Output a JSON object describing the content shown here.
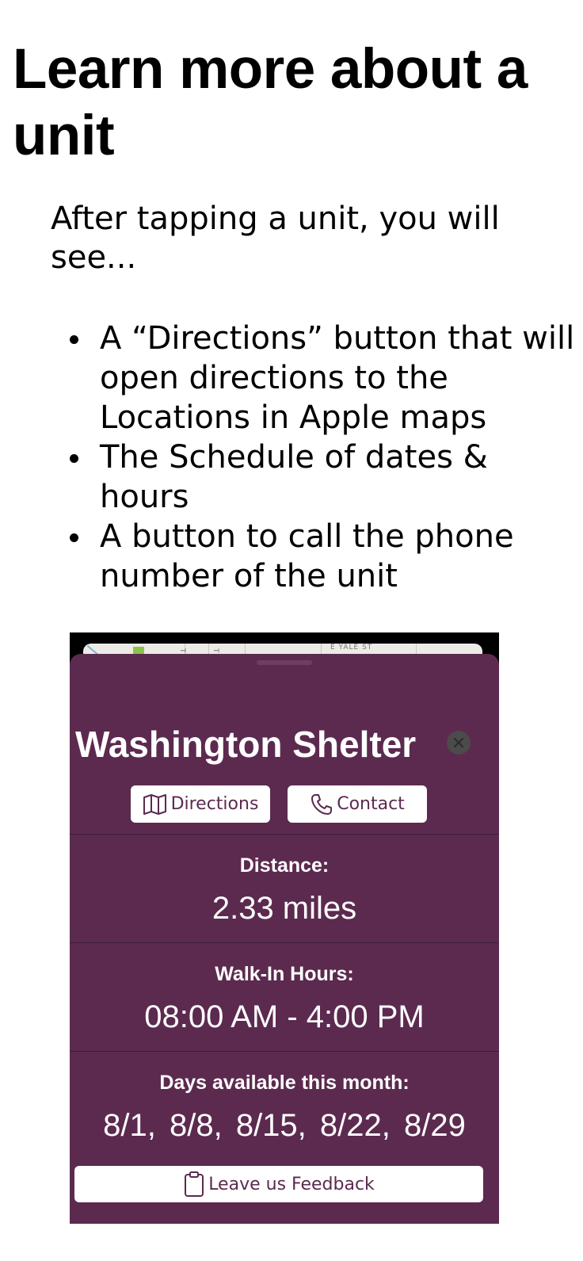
{
  "heading": "Learn more about a unit",
  "intro": "After tapping a unit, you will see...",
  "bullets": [
    "A “Directions” button that will open directions to the Locations in Apple maps",
    "The Schedule of dates & hours",
    "A button to call the phone number of the unit"
  ],
  "map": {
    "road_labels": [
      "TH",
      "TH",
      "E YALE ST"
    ]
  },
  "sheet": {
    "accent_color": "#5c2a4f",
    "unit_name": "Washington Shelter",
    "close_icon": "close-circle-icon",
    "buttons": {
      "directions_label": "Directions",
      "directions_icon": "map-icon",
      "contact_label": "Contact",
      "contact_icon": "phone-icon"
    },
    "distance": {
      "label": "Distance:",
      "value": "2.33 miles"
    },
    "hours": {
      "label": "Walk-In Hours:",
      "value": "08:00 AM - 4:00 PM"
    },
    "days": {
      "label": "Days available this month:",
      "value": "8/1, 8/8, 8/15, 8/22, 8/29"
    },
    "feedback": {
      "label": "Leave us Feedback",
      "icon": "clipboard-icon"
    }
  }
}
